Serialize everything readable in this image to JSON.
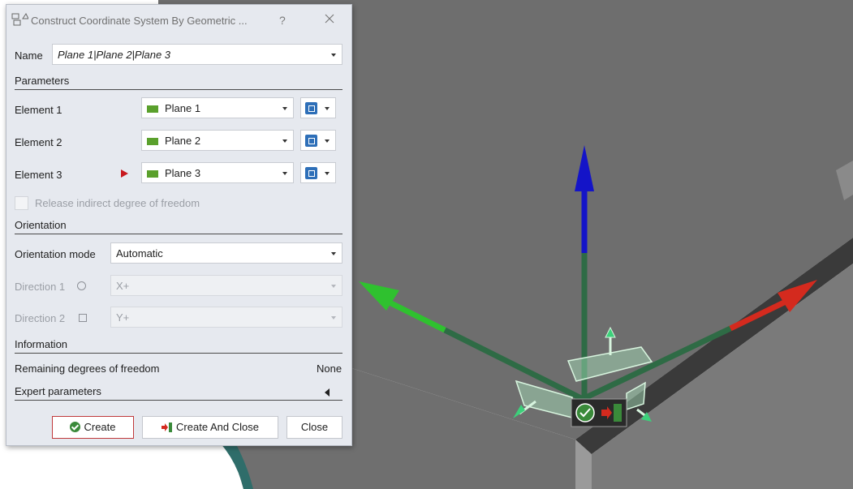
{
  "dialog": {
    "title": "Construct Coordinate System By Geometric ...",
    "help": "?",
    "name_label": "Name",
    "name_value": "Plane 1|Plane 2|Plane 3",
    "parameters_header": "Parameters",
    "elements": [
      {
        "label": "Element 1",
        "value": "Plane 1",
        "active": false
      },
      {
        "label": "Element 2",
        "value": "Plane 2",
        "active": false
      },
      {
        "label": "Element 3",
        "value": "Plane 3",
        "active": true
      }
    ],
    "release_label": "Release indirect degree of freedom",
    "orientation_header": "Orientation",
    "orientation_mode_label": "Orientation mode",
    "orientation_mode_value": "Automatic",
    "direction1_label": "Direction 1",
    "direction1_value": "X+",
    "direction2_label": "Direction 2",
    "direction2_value": "Y+",
    "information_header": "Information",
    "remaining_label": "Remaining degrees of freedom",
    "remaining_value": "None",
    "expert_label": "Expert parameters",
    "buttons": {
      "create": "Create",
      "create_and_close": "Create And Close",
      "close": "Close"
    }
  },
  "colors": {
    "dialog_bg": "#e6e9ef",
    "plane_green": "#5aa02c",
    "axis_x": "#d42a1e",
    "axis_y": "#2fc12f",
    "axis_z": "#1414c8",
    "viewport_gray": "#707070",
    "accent_red": "#c8191e"
  }
}
